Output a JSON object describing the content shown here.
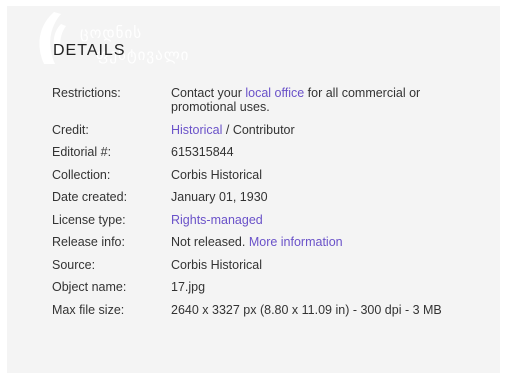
{
  "branding": {
    "logo_line1": "ცოდნის",
    "logo_line2": "ფესტივალი"
  },
  "section": {
    "title": "DETAILS"
  },
  "details": {
    "restrictions": {
      "label": "Restrictions:",
      "text1": "Contact your ",
      "link": "local office",
      "text2": " for all commercial or promotional uses."
    },
    "credit": {
      "label": "Credit:",
      "link": "Historical",
      "text": " / Contributor"
    },
    "editorial": {
      "label": "Editorial #:",
      "value": "615315844"
    },
    "collection": {
      "label": "Collection:",
      "value": "Corbis Historical"
    },
    "date_created": {
      "label": "Date created:",
      "value": "January 01, 1930"
    },
    "license_type": {
      "label": "License type:",
      "link": "Rights-managed"
    },
    "release_info": {
      "label": "Release info:",
      "text": "Not released. ",
      "link": "More information"
    },
    "source": {
      "label": "Source:",
      "value": "Corbis Historical"
    },
    "object_name": {
      "label": "Object name:",
      "value": "17.jpg"
    },
    "max_file_size": {
      "label": "Max file size:",
      "value": "2640 x 3327 px (8.80 x 11.09 in) - 300 dpi - 3 MB"
    }
  },
  "colors": {
    "panel_background": "#f4f4f4",
    "link": "#6a52c9",
    "text": "#333333"
  }
}
